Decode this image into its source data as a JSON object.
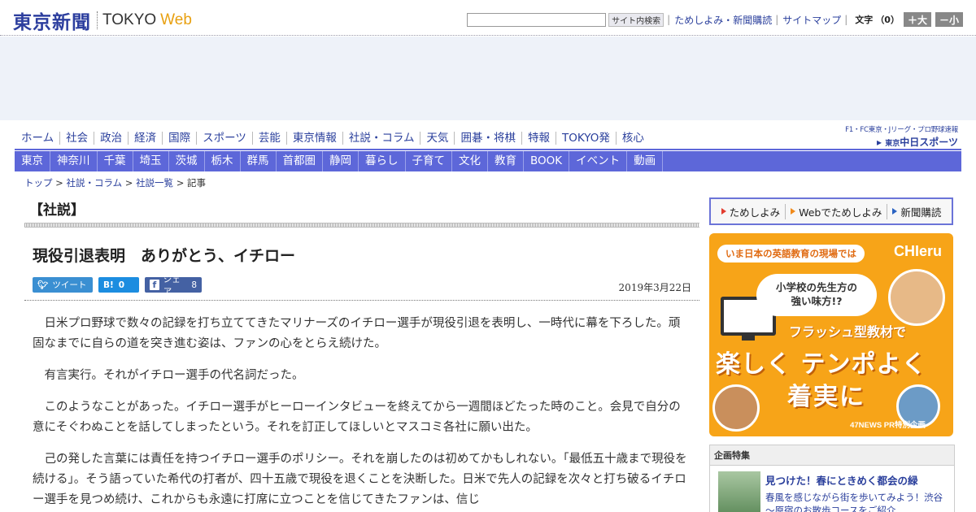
{
  "header": {
    "logo_jp": "東京新聞",
    "logo_en": "TOKYO",
    "logo_web": "Web",
    "search_button": "サイト内検索",
    "links": [
      "ためしよみ・新聞購読",
      "サイトマップ"
    ],
    "font_size_label": "文字",
    "font_size_value": "（0）",
    "larger_button": "＋大",
    "smaller_button": "－小"
  },
  "nav_primary": [
    "ホーム",
    "社会",
    "政治",
    "経済",
    "国際",
    "スポーツ",
    "芸能",
    "東京情報",
    "社説・コラム",
    "天気",
    "囲碁・将棋",
    "特報",
    "TOKYO発",
    "核心"
  ],
  "chunichi": {
    "tagline": "F1・FC東京・Jリーグ・プロ野球速報",
    "name_small": "東京",
    "name": "中日スポーツ"
  },
  "nav_regional": [
    "東京",
    "神奈川",
    "千葉",
    "埼玉",
    "茨城",
    "栃木",
    "群馬",
    "首都圏",
    "静岡",
    "暮らし",
    "子育て",
    "文化",
    "教育",
    "BOOK",
    "イベント",
    "動画"
  ],
  "breadcrumb": {
    "items": [
      "トップ",
      "社説・コラム",
      "社説一覧"
    ],
    "current": "記事",
    "separator": ">"
  },
  "article": {
    "section": "【社説】",
    "headline": "現役引退表明　ありがとう、イチロー",
    "date": "2019年3月22日",
    "social": {
      "tweet_label": "ツイート",
      "hatena_label": "B!",
      "hatena_count": "0",
      "facebook_label": "シェア",
      "facebook_count": "8"
    },
    "paragraphs": [
      "日米プロ野球で数々の記録を打ち立ててきたマリナーズのイチロー選手が現役引退を表明し、一時代に幕を下ろした。頑固なまでに自らの道を突き進む姿は、ファンの心をとらえ続けた。",
      "有言実行。それがイチロー選手の代名詞だった。",
      "このようなことがあった。イチロー選手がヒーローインタビューを終えてから一週間ほどたった時のこと。会見で自分の意にそぐわぬことを話してしまったという。それを訂正してほしいとマスコミ各社に願い出た。",
      "己の発した言葉には責任を持つイチロー選手のポリシー。それを崩したのは初めてかもしれない。「最低五十歳まで現役を続ける」。そう語っていた希代の打者が、四十五歳で現役を退くことを決断した。日米で先人の記録を次々と打ち破るイチロー選手を見つめ続け、これからも永遠に打席に立つことを信じてきたファンは、信じ"
    ]
  },
  "sidebar": {
    "subscribe_links": [
      "ためしよみ",
      "Webでためしよみ",
      "新聞購読"
    ],
    "banner": {
      "top": "いま日本の英語教育の現場では",
      "brand": "CHIeru",
      "bubble_line1": "小学校の先生方の",
      "bubble_line2": "強い味方!?",
      "mid": "フラッシュ型教材で",
      "big1": "楽しく テンポよく",
      "big2": "着実に",
      "footer": "47NEWS PR特別企画"
    },
    "feature": {
      "title": "企画特集",
      "headline": "見つけた！春にときめく都会の緑",
      "desc": "春風を感じながら街を歩いてみよう！渋谷～原宿のお散歩コースをご紹介"
    }
  }
}
